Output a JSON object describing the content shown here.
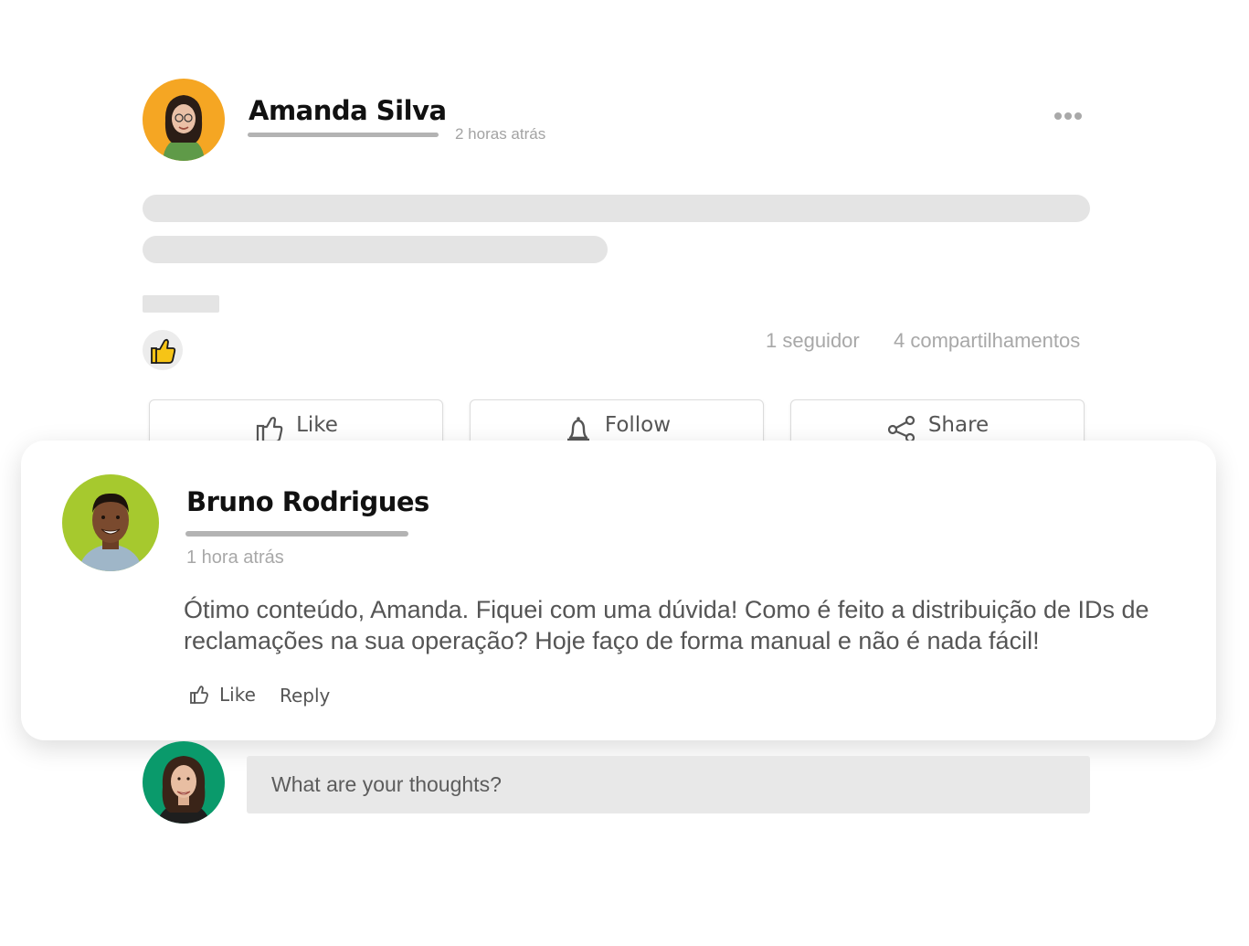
{
  "post": {
    "author_name": "Amanda Silva",
    "time": "2 horas atrás",
    "more_icon": "more-horizontal-icon",
    "reaction_icon": "thumbs-up-emoji-icon",
    "stats": {
      "followers": "1 seguidor",
      "shares": "4 compartilhamentos"
    },
    "actions": {
      "like": "Like",
      "follow": "Follow",
      "share": "Share"
    },
    "colors": {
      "author_avatar_bg": "#f5a623"
    }
  },
  "comment": {
    "author_name": "Bruno Rodrigues",
    "time": "1 hora atrás",
    "text": "Ótimo conteúdo, Amanda. Fiquei com uma dúvida! Como é feito a distribuição de IDs de reclamações na sua operação? Hoje faço de forma manual e não é nada fácil!",
    "like_label": "Like",
    "reply_label": "Reply",
    "colors": {
      "author_avatar_bg": "#a6c92e"
    }
  },
  "composer": {
    "placeholder": "What are your thoughts?",
    "colors": {
      "avatar_bg": "#0a9a6b"
    }
  }
}
